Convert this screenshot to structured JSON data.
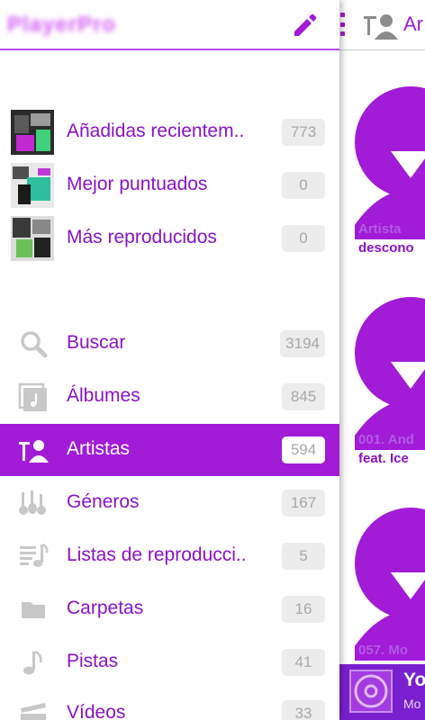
{
  "app": {
    "logo_text": "PlayerPro"
  },
  "drawer": {
    "playlists": [
      {
        "label": "Añadidas recientem..",
        "count": "773"
      },
      {
        "label": "Mejor puntuados",
        "count": "0"
      },
      {
        "label": "Más reproducidos",
        "count": "0"
      }
    ],
    "nav": [
      {
        "label": "Buscar",
        "count": "3194",
        "icon": "search-icon"
      },
      {
        "label": "Álbumes",
        "count": "845",
        "icon": "album-icon"
      },
      {
        "label": "Artistas",
        "count": "594",
        "icon": "artist-icon",
        "active": true
      },
      {
        "label": "Géneros",
        "count": "167",
        "icon": "genre-icon"
      },
      {
        "label": "Listas de reproducci..",
        "count": "5",
        "icon": "playlist-icon"
      },
      {
        "label": "Carpetas",
        "count": "16",
        "icon": "folder-icon"
      },
      {
        "label": "Pistas",
        "count": "41",
        "icon": "music-note-icon"
      },
      {
        "label": "Vídeos",
        "count": "33",
        "icon": "video-icon"
      }
    ]
  },
  "right_panel": {
    "title": "Ar",
    "cards": [
      {
        "line1": "Artista",
        "line2": "descono"
      },
      {
        "line1": "001. And",
        "line2": "feat. Ice"
      },
      {
        "line1": "057. Mo",
        "line2": ""
      }
    ],
    "mini_player": {
      "title": "Yo",
      "subtitle": "Mo"
    }
  },
  "colors": {
    "accent": "#a21bd6",
    "text_accent": "#8a12c8",
    "badge_bg": "#ececec",
    "badge_text": "#a8a8a8",
    "icon_gray": "#c8c8c8"
  }
}
